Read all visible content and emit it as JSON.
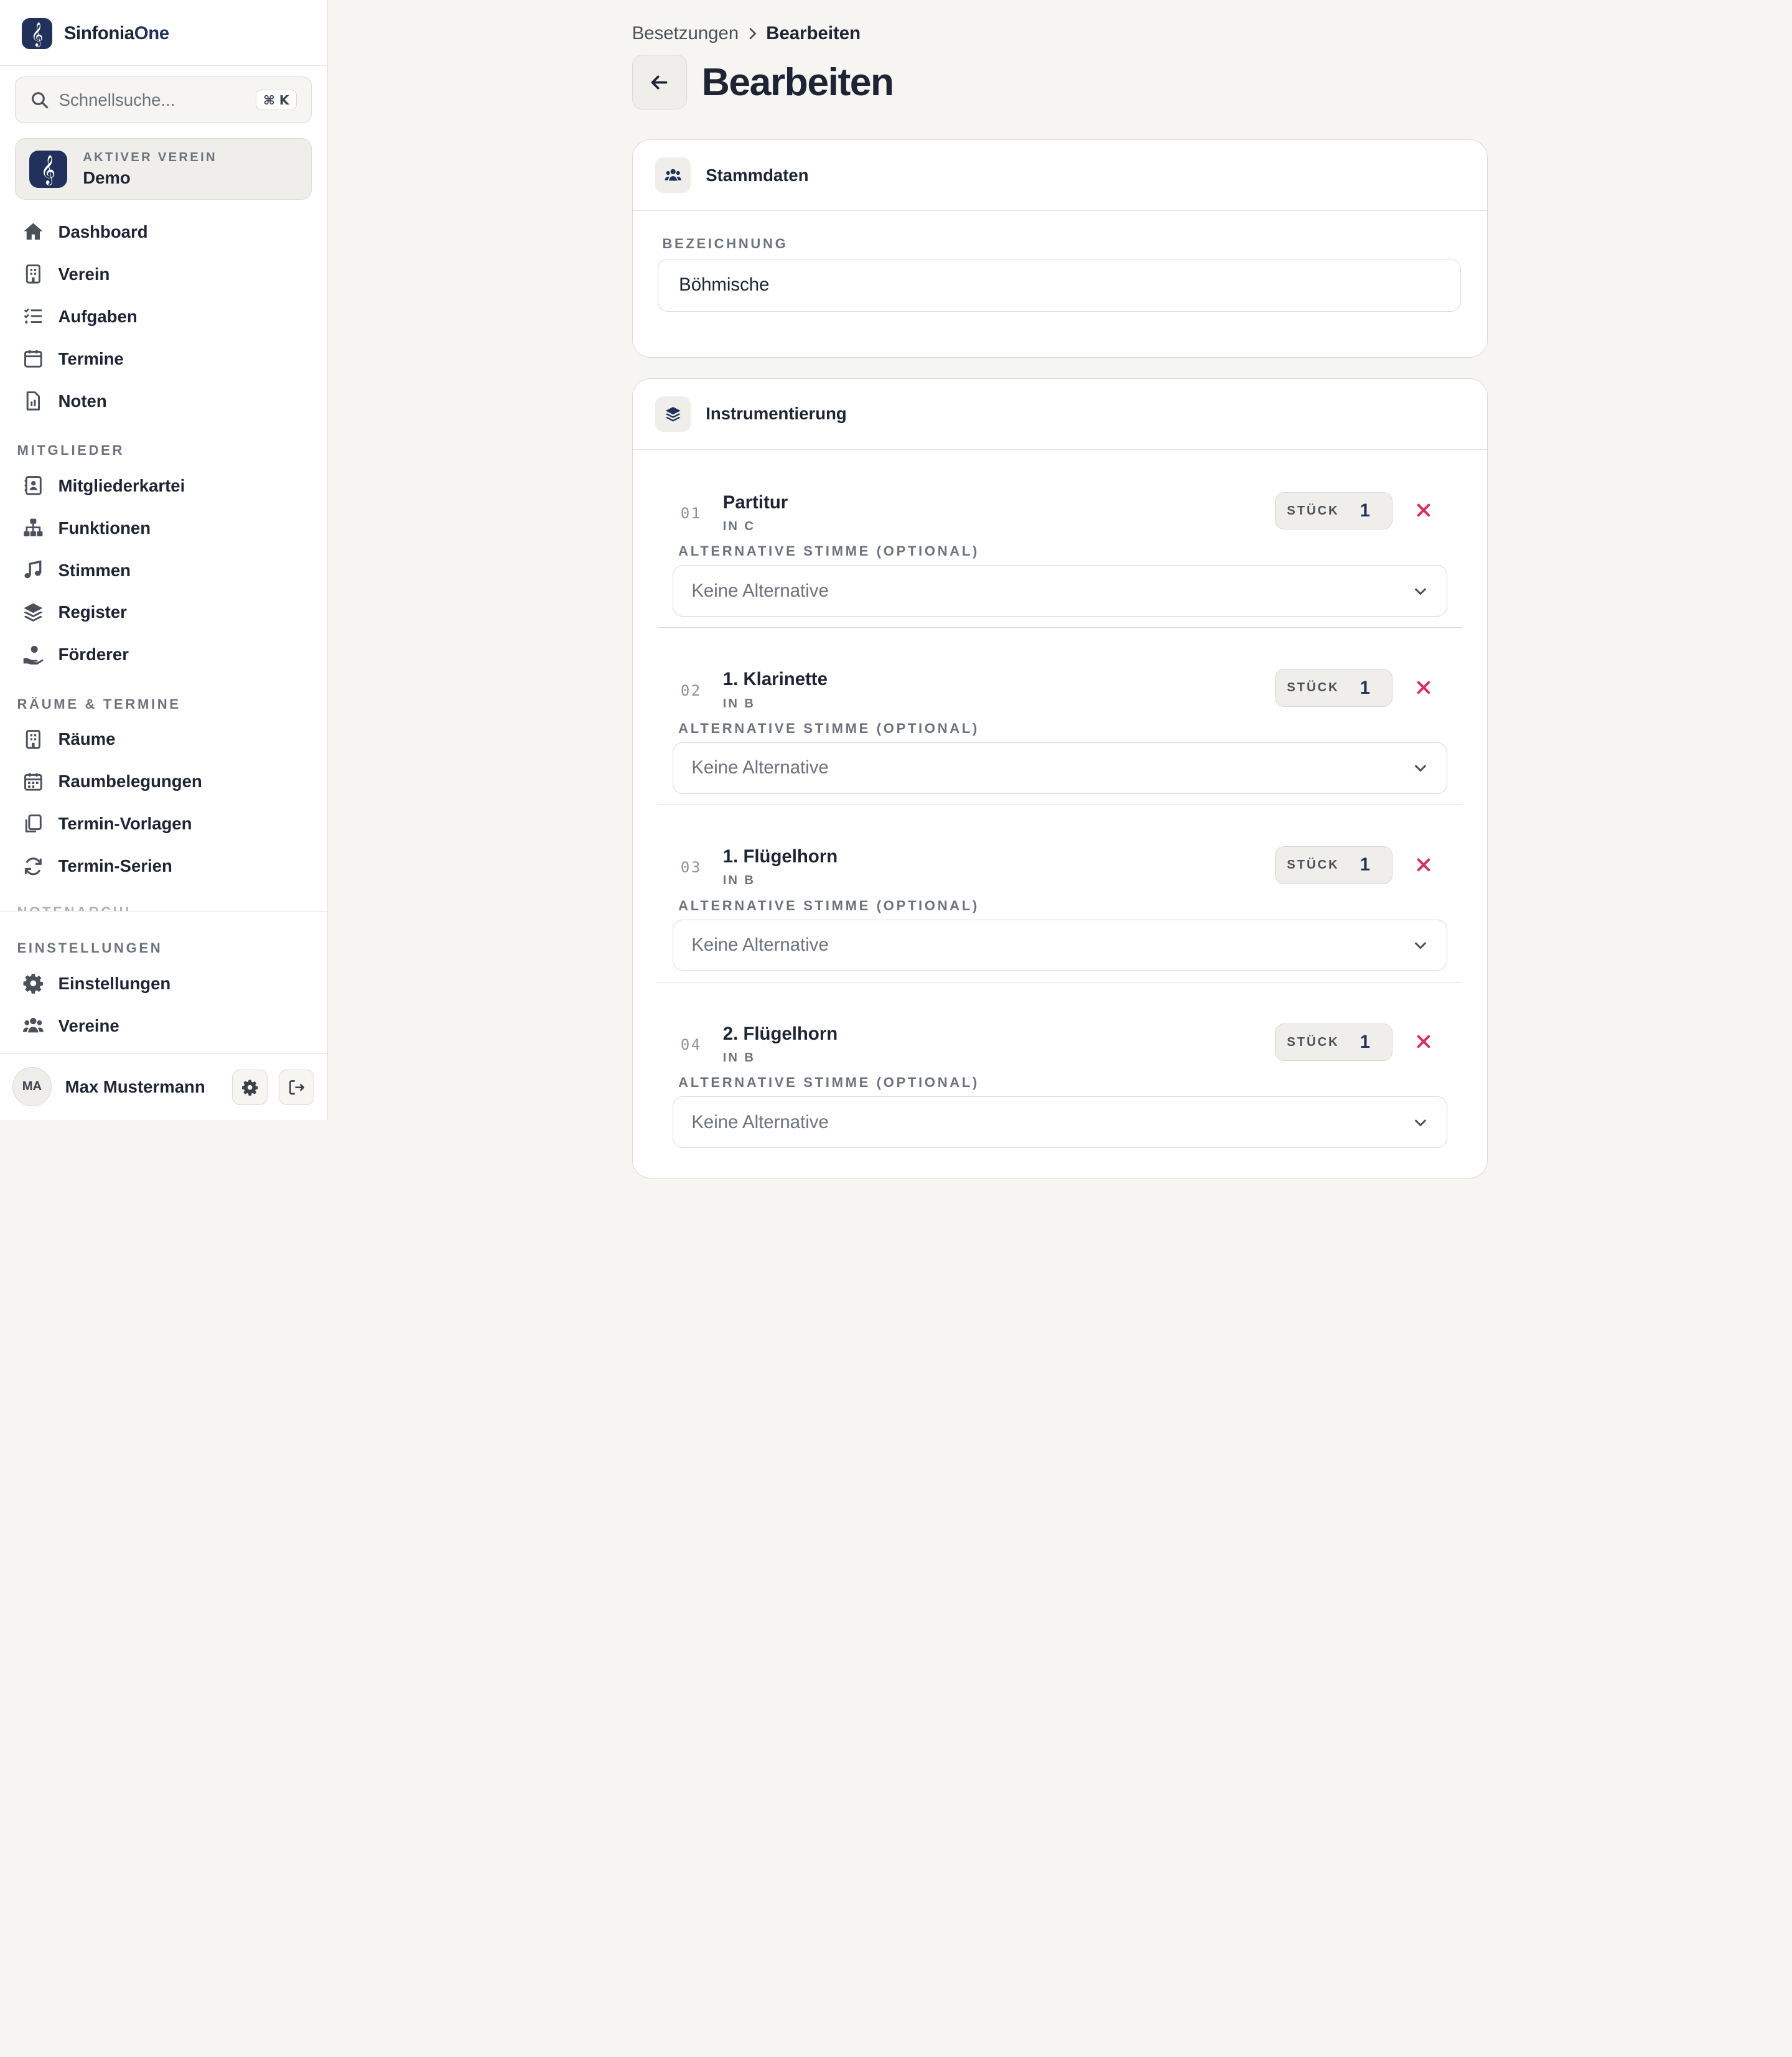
{
  "app": {
    "brand_primary": "Sinfonia",
    "brand_accent": "One",
    "brand_color": "#22315c"
  },
  "search": {
    "placeholder": "Schnellsuche...",
    "shortcut": "⌘ K"
  },
  "active_club": {
    "caption": "AKTIVER VEREIN",
    "name": "Demo"
  },
  "nav": {
    "main": [
      {
        "label": "Dashboard",
        "icon": "home-icon"
      },
      {
        "label": "Verein",
        "icon": "building-icon"
      },
      {
        "label": "Aufgaben",
        "icon": "tasks-icon"
      },
      {
        "label": "Termine",
        "icon": "calendar-icon"
      },
      {
        "label": "Noten",
        "icon": "sheet-music-file-icon"
      }
    ],
    "members_heading": "MITGLIEDER",
    "members": [
      {
        "label": "Mitgliederkartei",
        "icon": "contact-card-icon"
      },
      {
        "label": "Funktionen",
        "icon": "org-chart-icon"
      },
      {
        "label": "Stimmen",
        "icon": "music-note-icon"
      },
      {
        "label": "Register",
        "icon": "layers-icon"
      },
      {
        "label": "Förderer",
        "icon": "supporter-hand-icon"
      }
    ],
    "rooms_heading": "RÄUME & TERMINE",
    "rooms": [
      {
        "label": "Räume",
        "icon": "building-icon"
      },
      {
        "label": "Raumbelegungen",
        "icon": "calendar-grid-icon"
      },
      {
        "label": "Termin-Vorlagen",
        "icon": "copy-icon"
      },
      {
        "label": "Termin-Serien",
        "icon": "refresh-icon"
      }
    ],
    "cutoff_heading": "NOTENARCHIV",
    "settings_heading": "EINSTELLUNGEN",
    "settings": [
      {
        "label": "Einstellungen",
        "icon": "gear-icon"
      },
      {
        "label": "Vereine",
        "icon": "users-icon"
      }
    ]
  },
  "user": {
    "initials": "MA",
    "name": "Max Mustermann"
  },
  "breadcrumb": {
    "parent": "Besetzungen",
    "current": "Bearbeiten"
  },
  "page": {
    "title": "Bearbeiten"
  },
  "master_data": {
    "title": "Stammdaten",
    "name_label": "BEZEICHNUNG",
    "name_value": "Böhmische"
  },
  "instrumentation": {
    "title": "Instrumentierung",
    "qty_label": "STÜCK",
    "alt_label": "ALTERNATIVE STIMME (OPTIONAL)",
    "rows": [
      {
        "num": "01",
        "name": "Partitur",
        "tuning": "IN C",
        "qty": "1",
        "alternative": "Keine Alternative"
      },
      {
        "num": "02",
        "name": "1. Klarinette",
        "tuning": "IN B",
        "qty": "1",
        "alternative": "Keine Alternative"
      },
      {
        "num": "03",
        "name": "1. Flügelhorn",
        "tuning": "IN B",
        "qty": "1",
        "alternative": "Keine Alternative"
      },
      {
        "num": "04",
        "name": "2. Flügelhorn",
        "tuning": "IN B",
        "qty": "1",
        "alternative": "Keine Alternative"
      }
    ]
  },
  "colors": {
    "background": "#f6f5f2",
    "navy": "#22315c",
    "danger": "#d6335a"
  }
}
